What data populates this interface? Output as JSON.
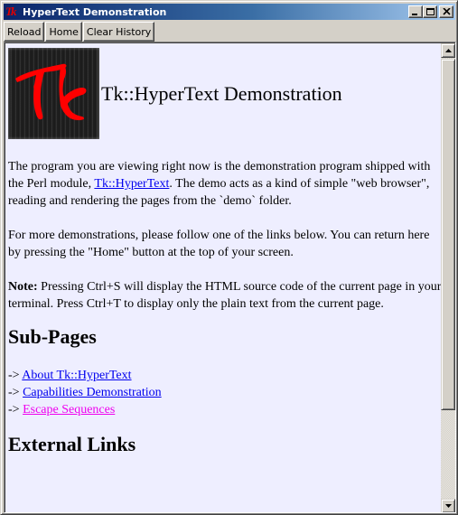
{
  "window": {
    "title": "HyperText Demonstration",
    "icon": "tk-icon",
    "icon_glyph": "Tk",
    "controls": [
      "minimize",
      "maximize",
      "close"
    ]
  },
  "toolbar": {
    "reload_label": "Reload",
    "home_label": "Home",
    "clear_history_label": "Clear History"
  },
  "page": {
    "background": "#eeeeff",
    "link_color": "#0000ee",
    "visited_link_color": "#ee00ee",
    "logo": "tk-logo",
    "title": "Tk::HyperText Demonstration",
    "intro": {
      "before_link": "The program you are viewing right now is the demonstration program shipped with the Perl module, ",
      "link": "Tk::HyperText",
      "after_link": ". The demo acts as a kind of simple \"web browser\", reading and rendering the pages from the `demo` folder."
    },
    "more": "For more demonstrations, please follow one of the links below. You can return here by pressing the \"Home\" button at the top of your screen.",
    "note": {
      "label": "Note:",
      "text": " Pressing Ctrl+S will display the HTML source code of the current page in your terminal. Press Ctrl+T to display only the plain text from the current page."
    },
    "subpages_heading": "Sub-Pages",
    "subpages": [
      {
        "prefix": "-> ",
        "label": "About Tk::HyperText",
        "visited": false
      },
      {
        "prefix": "-> ",
        "label": "Capabilities Demonstration",
        "visited": false
      },
      {
        "prefix": "-> ",
        "label": "Escape Sequences",
        "visited": true
      }
    ],
    "external_heading": "External Links"
  },
  "scrollbar": {
    "position_fraction": 0.0,
    "visible_fraction": 0.8
  }
}
